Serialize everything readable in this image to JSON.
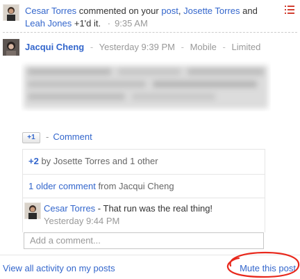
{
  "notification": {
    "actor": "Cesar Torres",
    "verb": " commented on your ",
    "post_link": "post",
    "comma": ", ",
    "actor2": "Josette Torres",
    "and": " and",
    "actor3": "Leah Jones",
    "plus": " +1'd it.",
    "dot": "·",
    "time": "9:35 AM",
    "menu_icon": "list-menu-icon"
  },
  "post": {
    "author": "Jacqui Cheng",
    "sep": "-",
    "time": "Yesterday 9:39 PM",
    "source": "Mobile",
    "visibility": "Limited"
  },
  "actions": {
    "plus_one": "+1",
    "dot": "-",
    "comment": "Comment"
  },
  "plus_ones": {
    "count": "+2",
    "text": " by Josette Torres and 1 other"
  },
  "older": {
    "link": "1 older comment",
    "text": " from Jacqui Cheng"
  },
  "comment": {
    "author": "Cesar Torres",
    "text": " - That run was the real thing!",
    "time": "Yesterday 9:44 PM"
  },
  "add_comment": {
    "placeholder": "Add a comment..."
  },
  "footer": {
    "view_all": "View all activity on my posts",
    "mute": "Mute this post"
  },
  "colors": {
    "link": "#3366cc",
    "meta": "#999999",
    "highlight": "#e8281c",
    "menu_icon": "#d23f31"
  }
}
